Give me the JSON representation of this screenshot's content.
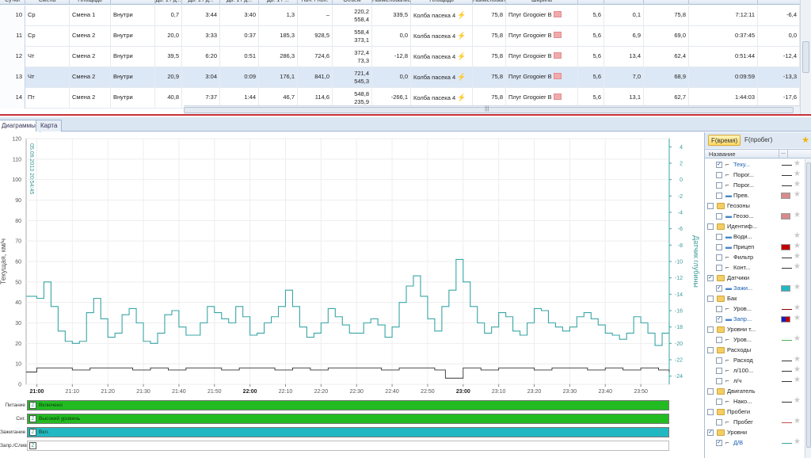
{
  "grid": {
    "headers": [
      "Сутки",
      "Смена",
      "Площадь",
      "",
      "Дв. 1 / д...",
      "Дв. 1 / д...",
      "Дв. 1 / д...",
      "Дв. 1 / ...",
      "Нач. / Кон.",
      "Объем",
      "Наименование",
      "Площадь",
      "Наименование",
      "Ширина",
      "",
      "",
      "",
      ""
    ],
    "rows": [
      {
        "n": "10",
        "day": "Ср",
        "shift": "Смена 1",
        "place": "Внутри",
        "v1": "0,7",
        "v2": "3:44",
        "v3": "3:40",
        "v4": "1,3",
        "v5": "–",
        "v6a": "220,2",
        "v6b": "558,4",
        "v7": "339,5",
        "name": "Колба пасека 4",
        "area": "75,8",
        "eq": "Плуг Grogoier B",
        "w": "5,6",
        "c1": "0,1",
        "c2": "75,8",
        "c3": "7:12:11",
        "c4": "-6,4",
        "sel": false
      },
      {
        "n": "11",
        "day": "Ср",
        "shift": "Смена 2",
        "place": "Внутри",
        "v1": "20,0",
        "v2": "3:33",
        "v3": "0:37",
        "v4": "185,3",
        "v5": "928,5",
        "v6a": "558,4",
        "v6b": "373,1",
        "v7": "0,0",
        "name": "Колба пасека 4",
        "area": "75,8",
        "eq": "Плуг Grogoier B",
        "w": "5,6",
        "c1": "6,9",
        "c2": "69,0",
        "c3": "0:37:45",
        "c4": "0,0",
        "sel": false
      },
      {
        "n": "12",
        "day": "Чт",
        "shift": "Смена 2",
        "place": "Внутри",
        "v1": "39,5",
        "v2": "6:20",
        "v3": "0:51",
        "v4": "286,3",
        "v5": "724,6",
        "v6a": "372,4",
        "v6b": "73,3",
        "v7": "-12,8",
        "name": "Колба пасека 4",
        "area": "75,8",
        "eq": "Плуг Grogoier B",
        "w": "5,6",
        "c1": "13,4",
        "c2": "62,4",
        "c3": "0:51:44",
        "c4": "-12,4",
        "sel": false
      },
      {
        "n": "13",
        "day": "Чт",
        "shift": "Смена 2",
        "place": "Внутри",
        "v1": "20,9",
        "v2": "3:04",
        "v3": "0:09",
        "v4": "176,1",
        "v5": "841,0",
        "v6a": "721,4",
        "v6b": "545,3",
        "v7": "0,0",
        "name": "Колба пасека 4",
        "area": "75,8",
        "eq": "Плуг Grogoier B",
        "w": "5,6",
        "c1": "7,0",
        "c2": "68,9",
        "c3": "0:09:59",
        "c4": "-13,3",
        "sel": true
      },
      {
        "n": "14",
        "day": "Пт",
        "shift": "Смена 2",
        "place": "Внутри",
        "v1": "40,8",
        "v2": "7:37",
        "v3": "1:44",
        "v4": "46,7",
        "v5": "114,6",
        "v6a": "548,8",
        "v6b": "235,9",
        "v7": "-266,1",
        "name": "Колба пасека 4",
        "area": "75,8",
        "eq": "Плуг Grogoier B",
        "w": "5,6",
        "c1": "13,1",
        "c2": "62,7",
        "c3": "1:44:03",
        "c4": "-17,6",
        "sel": false
      }
    ],
    "hscroll_grip": "|||"
  },
  "tabs": {
    "diagrams": "Диаграммы",
    "map": "Карта"
  },
  "chart_data": {
    "type": "line",
    "ylabel": "Текущая, км/ч",
    "ylabel_right": "Датчик глубины",
    "date_marker": "05.09.2013 20:54:45",
    "ylim": [
      0,
      120
    ],
    "yticks": [
      0,
      10,
      20,
      30,
      40,
      50,
      60,
      70,
      80,
      90,
      100,
      110,
      120
    ],
    "ylim_right": [
      -25,
      5
    ],
    "yticks_right": [
      4,
      2,
      0,
      -2,
      -4,
      -6,
      -8,
      -10,
      -12,
      -14,
      -16,
      -18,
      -20,
      -22,
      -24
    ],
    "x_ticks": [
      "21:00",
      "21:10",
      "21:20",
      "21:30",
      "21:40",
      "21:50",
      "22:00",
      "22:10",
      "22:20",
      "22:30",
      "22:40",
      "22:50",
      "23:00",
      "23:10",
      "23:20",
      "23:30",
      "23:40",
      "23:50"
    ],
    "x_ticks_bold": [
      "21:00",
      "22:00",
      "23:00"
    ],
    "x_minutes_range": [
      -3,
      178
    ],
    "series": [
      {
        "color": "#3aa5a5",
        "x": [
          -3,
          0,
          2,
          4,
          6,
          8,
          10,
          12,
          14,
          16,
          18,
          20,
          22,
          24,
          26,
          28,
          30,
          32,
          34,
          36,
          38,
          40,
          42,
          44,
          46,
          48,
          50,
          52,
          54,
          56,
          58,
          60,
          62,
          64,
          66,
          68,
          70,
          72,
          74,
          76,
          78,
          80,
          82,
          84,
          86,
          88,
          90,
          92,
          94,
          96,
          98,
          100,
          102,
          104,
          106,
          108,
          110,
          112,
          114,
          116,
          118,
          120,
          122,
          124,
          126,
          128,
          130,
          132,
          134,
          136,
          138,
          140,
          142,
          144,
          146,
          148,
          150,
          152,
          154,
          156,
          158,
          160,
          162,
          164,
          166,
          168,
          170,
          172,
          174,
          176,
          178
        ],
        "values": [
          43,
          42,
          50,
          38,
          26,
          21,
          20,
          21,
          35,
          42,
          32,
          23,
          25,
          34,
          37,
          30,
          21,
          20,
          25,
          34,
          36,
          28,
          24,
          24,
          30,
          38,
          35,
          32,
          30,
          38,
          33,
          24,
          25,
          30,
          33,
          38,
          46,
          38,
          28,
          23,
          25,
          30,
          37,
          33,
          29,
          25,
          25,
          30,
          32,
          29,
          23,
          28,
          40,
          48,
          53,
          43,
          32,
          26,
          38,
          46,
          61,
          50,
          38,
          30,
          25,
          28,
          35,
          33,
          26,
          24,
          30,
          37,
          36,
          30,
          28,
          26,
          28,
          33,
          35,
          32,
          29,
          25,
          24,
          22,
          25,
          33,
          30,
          25,
          19,
          25,
          30
        ]
      },
      {
        "color": "#333333",
        "x": [
          -3,
          0,
          5,
          10,
          15,
          18,
          22,
          27,
          32,
          37,
          42,
          47,
          52,
          57,
          62,
          67,
          72,
          77,
          82,
          87,
          92,
          97,
          102,
          107,
          112,
          115,
          120,
          125,
          130,
          135,
          140,
          145,
          150,
          155,
          160,
          165,
          170,
          175,
          178
        ],
        "values": [
          6,
          8,
          8,
          7,
          8,
          8,
          8,
          7,
          8,
          7,
          8,
          8,
          7,
          8,
          8,
          7,
          8,
          7,
          8,
          8,
          8,
          7,
          8,
          8,
          7,
          3,
          8,
          7,
          8,
          8,
          7,
          8,
          8,
          7,
          8,
          7,
          8,
          7,
          6
        ]
      }
    ]
  },
  "bands": [
    {
      "label": "Питание",
      "text": "Включено",
      "color": "#22bb22",
      "icon": "Z"
    },
    {
      "label": "Сиг.",
      "text": "Высокий уровень",
      "color": "#22bb22",
      "icon": "Z"
    },
    {
      "label": "Зажигание",
      "text": "Вкл.",
      "color": "#22b8c2",
      "icon": "Z"
    },
    {
      "label": "Запр./Слив",
      "text": "",
      "color": "#ffffff",
      "icon": "Z"
    }
  ],
  "panel": {
    "tab_time": "F(время)",
    "tab_run": "F(пробег)",
    "header_name": "Название",
    "header_dots": "...",
    "tree": [
      {
        "label": "Теку...",
        "indent": 2,
        "checked": true,
        "kind": "line",
        "color": "#333333",
        "blue": true
      },
      {
        "label": "Порог...",
        "indent": 2,
        "checked": false,
        "kind": "line",
        "color": "#333333"
      },
      {
        "label": "Порог...",
        "indent": 2,
        "checked": false,
        "kind": "line",
        "color": "#333333"
      },
      {
        "label": "Прев.",
        "indent": 2,
        "checked": false,
        "kind": "swatch",
        "color": "#d98a8c"
      },
      {
        "label": "Геозоны",
        "indent": 0,
        "checked": false,
        "kind": "folder"
      },
      {
        "label": "Геозо...",
        "indent": 2,
        "checked": false,
        "kind": "swatch",
        "color": "#d98a8c"
      },
      {
        "label": "Идентиф...",
        "indent": 0,
        "checked": false,
        "kind": "folder"
      },
      {
        "label": "Води...",
        "indent": 2,
        "checked": false,
        "kind": "star"
      },
      {
        "label": "Прицеп",
        "indent": 2,
        "checked": false,
        "kind": "swatch",
        "color": "#c00000"
      },
      {
        "label": "Фильтр",
        "indent": 2,
        "checked": false,
        "kind": "line",
        "color": "#333333"
      },
      {
        "label": "Конт...",
        "indent": 2,
        "checked": false,
        "kind": "line",
        "color": "#333333"
      },
      {
        "label": "Датчики",
        "indent": 0,
        "checked": true,
        "kind": "folder"
      },
      {
        "label": "Зажи...",
        "indent": 2,
        "checked": true,
        "kind": "swatch",
        "color": "#22b8c2",
        "blue": true
      },
      {
        "label": "Бак",
        "indent": 0,
        "checked": false,
        "kind": "folder"
      },
      {
        "label": "Уров...",
        "indent": 2,
        "checked": false,
        "kind": "line",
        "color": "#8b0000"
      },
      {
        "label": "Запр...",
        "indent": 2,
        "checked": true,
        "kind": "swatch2",
        "color": "#1020c0",
        "blue": true
      },
      {
        "label": "Уровни т...",
        "indent": 0,
        "checked": false,
        "kind": "folder"
      },
      {
        "label": "Уров...",
        "indent": 2,
        "checked": false,
        "kind": "line",
        "color": "#4caf50"
      },
      {
        "label": "Расходы",
        "indent": 0,
        "checked": false,
        "kind": "folder"
      },
      {
        "label": "Расход",
        "indent": 2,
        "checked": false,
        "kind": "line",
        "color": "#333333"
      },
      {
        "label": "л/100...",
        "indent": 2,
        "checked": false,
        "kind": "line",
        "color": "#333333"
      },
      {
        "label": "л/ч",
        "indent": 2,
        "checked": false,
        "kind": "line",
        "color": "#333333"
      },
      {
        "label": "Двигатель",
        "indent": 0,
        "checked": false,
        "kind": "folder"
      },
      {
        "label": "Нако...",
        "indent": 2,
        "checked": false,
        "kind": "line",
        "color": "#333333"
      },
      {
        "label": "Пробеги",
        "indent": 0,
        "checked": false,
        "kind": "folder"
      },
      {
        "label": "Пробег",
        "indent": 2,
        "checked": false,
        "kind": "line",
        "color": "#c0504d"
      },
      {
        "label": "Уровни",
        "indent": 0,
        "checked": true,
        "kind": "folder"
      },
      {
        "label": "Д/В",
        "indent": 2,
        "checked": true,
        "kind": "line",
        "color": "#3aa5a5",
        "blue": true
      }
    ]
  }
}
